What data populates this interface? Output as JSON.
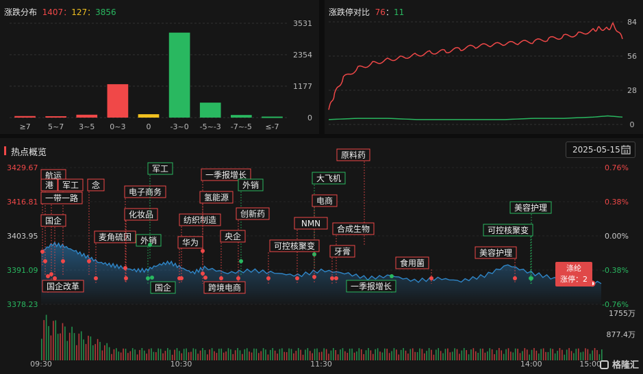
{
  "dist_panel": {
    "title": "涨跌分布",
    "up": "1407",
    "flat": "127",
    "down": "3856",
    "sep": "："
  },
  "ratio_panel": {
    "title": "涨跌停对比",
    "up": "76",
    "down": "11",
    "sep": "："
  },
  "hot_panel": {
    "title": "热点概览",
    "date": "2025-05-15",
    "tooltip_name": "涤纶",
    "tooltip_text": "涨停：2"
  },
  "logo": "格隆汇",
  "colors": {
    "up": "#f04848",
    "down": "#29b860",
    "flat": "#f0c020",
    "line": "#2f86c8"
  },
  "chart_data": [
    {
      "type": "bar",
      "title": "涨跌分布",
      "categories": [
        "≥7",
        "5~7",
        "3~5",
        "0~3",
        "0",
        "-3~0",
        "-5~-3",
        "-7~-5",
        "≤-7"
      ],
      "values": [
        58,
        52,
        108,
        1250,
        127,
        3180,
        560,
        98,
        38
      ],
      "bar_colors": [
        "#f04848",
        "#f04848",
        "#f04848",
        "#f04848",
        "#f0c020",
        "#29b860",
        "#29b860",
        "#29b860",
        "#29b860"
      ],
      "yticks": [
        "3531",
        "2354",
        "1177",
        "0"
      ],
      "ylim": [
        0,
        3531
      ]
    },
    {
      "type": "line",
      "title": "涨跌停对比",
      "yticks": [
        "84",
        "56",
        "28",
        "0"
      ],
      "ylim": [
        0,
        84
      ],
      "series": [
        {
          "color": "#f04848",
          "x": [
            0,
            2,
            5,
            10,
            15,
            20,
            25,
            30,
            35,
            40,
            45,
            50,
            55,
            60,
            65,
            70,
            75,
            80,
            85,
            90,
            92,
            95,
            97,
            100
          ],
          "values": [
            12,
            25,
            38,
            46,
            50,
            53,
            55,
            57,
            59,
            60,
            62,
            64,
            65,
            66,
            67,
            68,
            70,
            72,
            74,
            77,
            79,
            78,
            82,
            70
          ]
        },
        {
          "color": "#29b860",
          "x": [
            0,
            10,
            20,
            30,
            40,
            50,
            60,
            70,
            80,
            90,
            95,
            100
          ],
          "values": [
            4,
            5,
            5,
            4,
            4,
            4,
            4,
            5,
            5,
            6,
            7,
            6
          ]
        }
      ]
    },
    {
      "type": "line",
      "title": "热点概览",
      "x_ticks": [
        "09:30",
        "10:30",
        "11:30",
        "14:00",
        "15:00"
      ],
      "y_left_ticks": [
        "3429.67",
        "3416.81",
        "3403.95",
        "3391.09",
        "3378.23"
      ],
      "y_right_ticks": [
        "0.76%",
        "0.38%",
        "0.00%",
        "-0.38%",
        "-0.76%"
      ],
      "ylim": [
        3378.23,
        3429.67
      ],
      "volume_ticks": [
        "1755万",
        "877.4万"
      ],
      "series": [
        {
          "name": "",
          "x": [
            0,
            5,
            10,
            15,
            20,
            25,
            30,
            35,
            40,
            45,
            50,
            55,
            60,
            65,
            70,
            80,
            90,
            100,
            110,
            120,
            130,
            140,
            150,
            160,
            170,
            180,
            190,
            200,
            210,
            220,
            230,
            240
          ],
          "values": [
            3398,
            3401,
            3400,
            3398,
            3396,
            3394,
            3393,
            3392,
            3391,
            3391,
            3393,
            3394,
            3392,
            3390,
            3392,
            3390,
            3391,
            3390,
            3389,
            3391,
            3390,
            3388,
            3389,
            3387,
            3388,
            3387,
            3389,
            3393,
            3390,
            3388,
            3387,
            3386
          ]
        }
      ],
      "tags": [
        {
          "label": "航运",
          "color": "red"
        },
        {
          "label": "港",
          "color": "red"
        },
        {
          "label": "军工",
          "color": "red"
        },
        {
          "label": "念",
          "color": "red"
        },
        {
          "label": "一带一路",
          "color": "red"
        },
        {
          "label": "国企",
          "color": "red"
        },
        {
          "label": "国企改革",
          "color": "red"
        },
        {
          "label": "麦角硫因",
          "color": "red"
        },
        {
          "label": "电子商务",
          "color": "red"
        },
        {
          "label": "化妆品",
          "color": "red"
        },
        {
          "label": "外销",
          "color": "green"
        },
        {
          "label": "国企",
          "color": "green"
        },
        {
          "label": "军工",
          "color": "green"
        },
        {
          "label": "纺织制造",
          "color": "red"
        },
        {
          "label": "华为",
          "color": "red"
        },
        {
          "label": "一季报增长",
          "color": "red"
        },
        {
          "label": "氢能源",
          "color": "red"
        },
        {
          "label": "外销",
          "color": "green"
        },
        {
          "label": "创新药",
          "color": "red"
        },
        {
          "label": "央企",
          "color": "red"
        },
        {
          "label": "跨境电商",
          "color": "red"
        },
        {
          "label": "原料药",
          "color": "red"
        },
        {
          "label": "大飞机",
          "color": "green"
        },
        {
          "label": "电商",
          "color": "red"
        },
        {
          "label": "NMN",
          "color": "red"
        },
        {
          "label": "可控核聚变",
          "color": "red"
        },
        {
          "label": "合成生物",
          "color": "red"
        },
        {
          "label": "牙膏",
          "color": "red"
        },
        {
          "label": "一季报增长",
          "color": "green"
        },
        {
          "label": "食用菌",
          "color": "red"
        },
        {
          "label": "美容护理",
          "color": "green"
        },
        {
          "label": "可控核聚变",
          "color": "green"
        },
        {
          "label": "美容护理",
          "color": "red"
        }
      ]
    }
  ]
}
